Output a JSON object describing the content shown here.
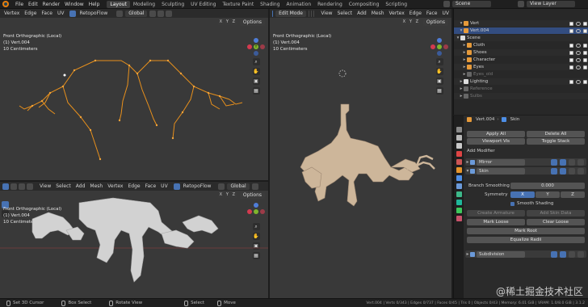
{
  "top_menu": [
    "File",
    "Edit",
    "Render",
    "Window",
    "Help"
  ],
  "workspaces": [
    "Layout",
    "Modeling",
    "Sculpting",
    "UV Editing",
    "Texture Paint",
    "Shading",
    "Animation",
    "Rendering",
    "Compositing",
    "Scripting"
  ],
  "active_workspace": "Layout",
  "scene": "Scene",
  "view_layer": "View Layer",
  "viewport_header_menu": [
    "Vertex",
    "Edge",
    "Face",
    "UV"
  ],
  "viewport_full_menu": [
    "View",
    "Select",
    "Add",
    "Mesh",
    "Vertex",
    "Edge",
    "Face",
    "UV"
  ],
  "right_viewport_menu": [
    "View",
    "Select",
    "Add",
    "Mesh",
    "Vertex",
    "Edge",
    "Face",
    "UV"
  ],
  "edit_mode": "Edit Mode",
  "retopoflow": "RetopoFlow",
  "transform_orientation": "Global",
  "axis_toggles": [
    "X",
    "Y",
    "Z"
  ],
  "options_label": "Options",
  "viewport_info": {
    "line1": "Front Orthographic (Local)",
    "line2": "(1) Vert.004",
    "line3": "10 Centimeters"
  },
  "gizmo_y": "Y",
  "outliner": [
    {
      "name": "Vert",
      "color": "#e69a3a"
    },
    {
      "name": "Vert.004",
      "color": "#e69a3a"
    },
    {
      "name": "Scene",
      "color": "#ffffff"
    },
    {
      "name": "Cloth",
      "color": "#e69a3a"
    },
    {
      "name": "Shoes",
      "color": "#e69a3a"
    },
    {
      "name": "Character",
      "color": "#e69a3a"
    },
    {
      "name": "Eyes",
      "color": "#e69a3a"
    },
    {
      "name": "Eyes_old",
      "color": "#888888"
    },
    {
      "name": "Lighting",
      "color": "#ffffff"
    },
    {
      "name": "Reference",
      "color": "#888888"
    },
    {
      "name": "Sulbs",
      "color": "#888888"
    }
  ],
  "properties": {
    "object_name": "Vert.004",
    "modifier_tab": "Skin",
    "apply_all": "Apply All",
    "delete_all": "Delete All",
    "viewport_vis": "Viewport Vis",
    "toggle_stack": "Toggle Stack",
    "add_modifier": "Add Modifier",
    "mod_mirror": "Mirror",
    "mod_skin": "Skin",
    "branch_smoothing_label": "Branch Smoothing",
    "branch_smoothing_value": "0.000",
    "symmetry_label": "Symmetry",
    "symmetry": [
      "X",
      "Y",
      "Z"
    ],
    "smooth_shading": "Smooth Shading",
    "create_armature": "Create Armature",
    "add_skin_data": "Add Skin Data",
    "mark_loose": "Mark Loose",
    "clear_loose": "Clear Loose",
    "mark_root": "Mark Root",
    "equalize_radii": "Equalize Radii",
    "mod_subdivision": "Subdivision"
  },
  "statusbar": {
    "set_cursor": "Set 3D Cursor",
    "box_select": "Box Select",
    "rotate_view": "Rotate View",
    "select": "Select",
    "move": "Move",
    "stats": "Vert.004 | Verts 0/343 | Edges 0/737 | Faces 0/45 | Tris 0 | Objects 0/43 | Memory: 6.01 GiB | VRAM: 1.0/8.0 GiB | 3.1.2"
  },
  "watermark": "@稀土掘金技术社区",
  "colors": {
    "accent": "#4772b3",
    "wire": "#e8901c",
    "model": "#d2d2d2",
    "skin_model": "#cdb69a",
    "bone_icon": "#1fb89a"
  }
}
